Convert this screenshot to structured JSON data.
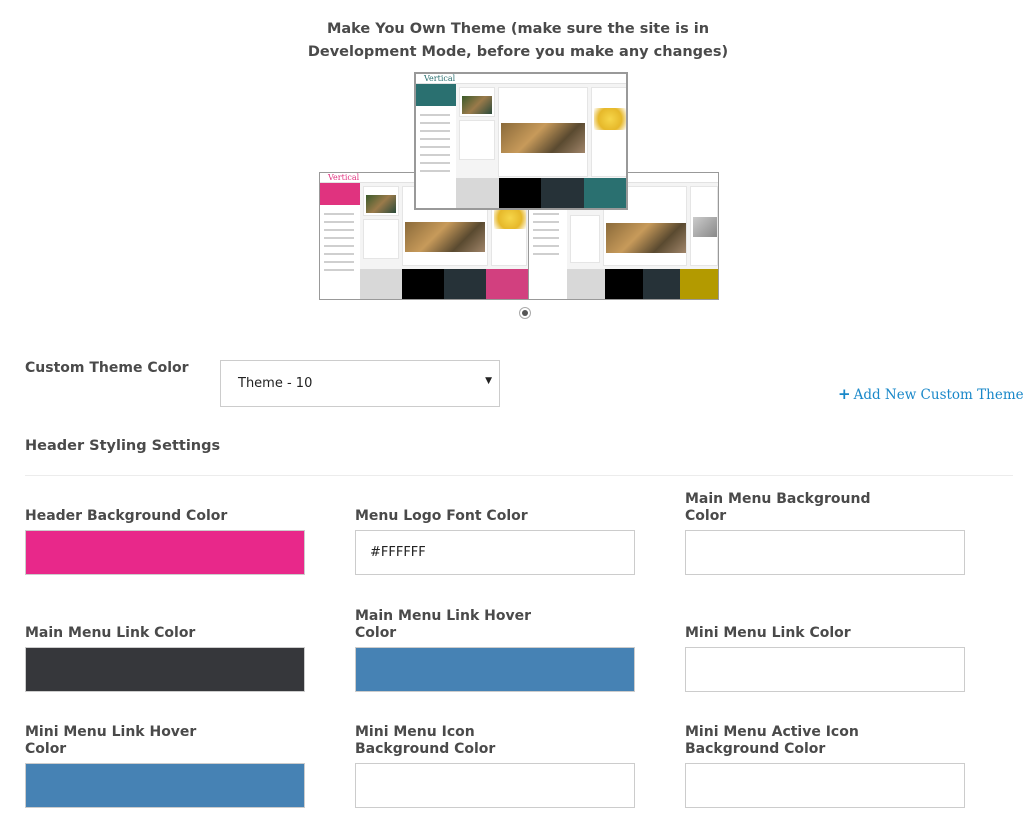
{
  "title": {
    "line1": "Make You Own Theme (make sure the site is in",
    "line2": "Development Mode, before you make any changes)"
  },
  "preview": {
    "logo_text": "Vertical",
    "themes": [
      {
        "name": "teal-theme",
        "accent": "#2a7070",
        "swatches": [
          "#d8d8d8",
          "#000000",
          "#263238",
          "#2a7070"
        ]
      },
      {
        "name": "pink-theme",
        "accent": "#e0337f",
        "swatches": [
          "#d8d8d8",
          "#000000",
          "#263238",
          "#d2407f"
        ]
      },
      {
        "name": "gold-theme",
        "accent": "#b49a00",
        "swatches": [
          "#d8d8d8",
          "#000000",
          "#263238",
          "#b39a00"
        ]
      }
    ],
    "carousel_active_index": 0
  },
  "custom_theme": {
    "label": "Custom Theme Color",
    "selected": "Theme - 10",
    "arrow": "▼",
    "add_label": "Add New Custom Theme",
    "add_icon": "+"
  },
  "section_title": "Header Styling Settings",
  "fields": [
    {
      "label1": "Header Background Color",
      "label2": "",
      "value": "",
      "color": "#e8288a"
    },
    {
      "label1": "Menu Logo Font Color",
      "label2": "",
      "value": "#FFFFFF",
      "color": "#ffffff"
    },
    {
      "label1": "Main Menu Background",
      "label2": "Color",
      "value": "",
      "color": "#ffffff"
    },
    {
      "label1": "Main Menu Link Color",
      "label2": "",
      "value": "",
      "color": "#36373b"
    },
    {
      "label1": "Main Menu Link Hover",
      "label2": "Color",
      "value": "",
      "color": "#4682b4"
    },
    {
      "label1": "Mini Menu Link Color",
      "label2": "",
      "value": "",
      "color": "#ffffff"
    },
    {
      "label1": "Mini Menu Link Hover",
      "label2": "Color",
      "value": "",
      "color": "#4682b4"
    },
    {
      "label1": "Mini Menu Icon",
      "label2": "Background Color",
      "value": "",
      "color": "#ffffff"
    },
    {
      "label1": "Mini Menu Active Icon",
      "label2": "Background Color",
      "value": "",
      "color": "#ffffff"
    }
  ]
}
